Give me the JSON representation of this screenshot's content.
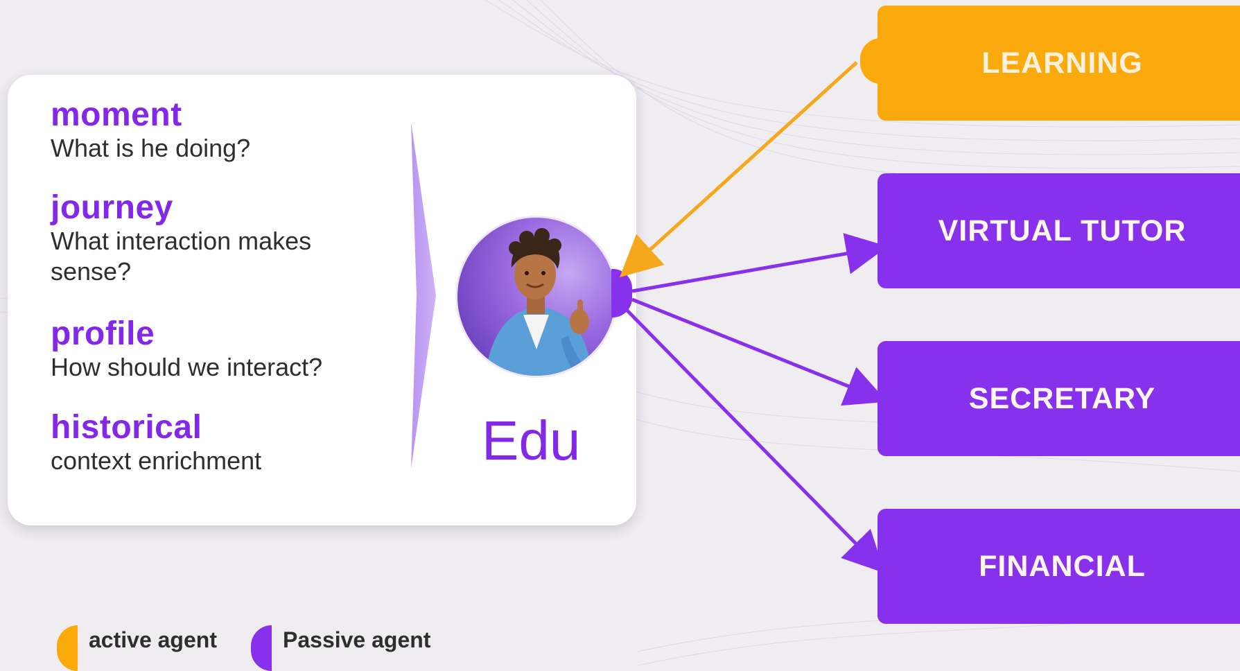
{
  "context_card": {
    "items": [
      {
        "heading": "moment",
        "text": "What is he doing?"
      },
      {
        "heading": "journey",
        "text": "What interaction makes sense?"
      },
      {
        "heading": "profile",
        "text": "How should we interact?"
      },
      {
        "heading": "historical",
        "text": "context enrichment"
      }
    ]
  },
  "center": {
    "avatar_icon": "person-avatar-icon",
    "label": "Edu"
  },
  "agents": [
    {
      "label": "LEARNING",
      "type": "active",
      "color": "#fbaa0d"
    },
    {
      "label": "VIRTUAL TUTOR",
      "type": "passive",
      "color": "#8731ec"
    },
    {
      "label": "SECRETARY",
      "type": "passive",
      "color": "#8731ec"
    },
    {
      "label": "FINANCIAL",
      "type": "passive",
      "color": "#8731ec"
    }
  ],
  "legend": {
    "active_label": "active agent",
    "passive_label": "Passive agent",
    "active_color": "#fbaa0d",
    "passive_color": "#8731ec"
  },
  "colors": {
    "accent_purple": "#8327e8",
    "accent_orange": "#fbaa0d"
  }
}
